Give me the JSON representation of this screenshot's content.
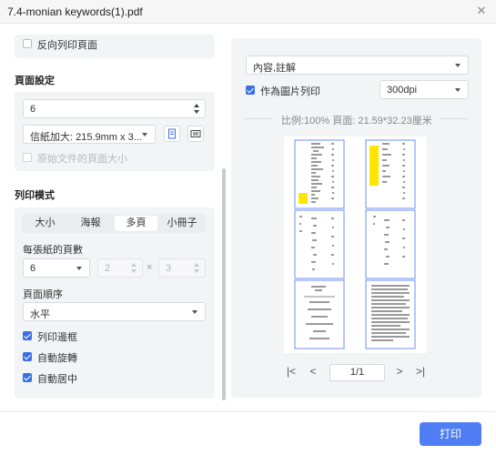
{
  "window": {
    "title": "7.4-monian keywords(1).pdf"
  },
  "reverse_print": {
    "label": "反向列印頁面",
    "checked": false
  },
  "page_setup": {
    "heading": "頁面設定",
    "copies_value": "6",
    "paper_size": "信紙加大: 215.9mm x 3...",
    "original_size": {
      "label": "原始文件的頁面大小",
      "checked": false
    }
  },
  "print_mode": {
    "heading": "列印模式",
    "tabs": [
      "大小",
      "海報",
      "多頁",
      "小冊子"
    ],
    "active_tab": "多頁",
    "pages_per_sheet_label": "每張紙的頁數",
    "pages_per_sheet_value": "6",
    "cols_value": "2",
    "times_sign": "×",
    "rows_value": "3",
    "order_label": "頁面順序",
    "order_value": "水平",
    "options": [
      {
        "label": "列印邊框",
        "checked": true
      },
      {
        "label": "自動旋轉",
        "checked": true
      },
      {
        "label": "自動居中",
        "checked": true
      }
    ]
  },
  "preview": {
    "content_select": "內容,註解",
    "print_as_image": {
      "label": "作為圖片列印",
      "checked": true
    },
    "dpi": "300dpi",
    "scale_info": "比例:100%  頁面: 21.59*32.23厘米",
    "pager": {
      "current": "1/1"
    }
  },
  "footer": {
    "print_button": "打印"
  },
  "colors": {
    "accent": "#4f7ef4",
    "page_border": "#6f8ff0",
    "highlight": "#ffe600"
  },
  "icons": [
    "close-icon",
    "first-page-icon",
    "prev-page-icon",
    "next-page-icon",
    "last-page-icon",
    "portrait-icon",
    "landscape-icon"
  ]
}
